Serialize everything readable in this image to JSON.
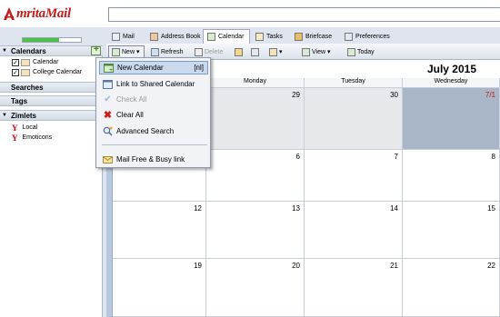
{
  "app": {
    "logo_prefix": "A",
    "logo_text": "mrita",
    "logo_suffix": "Mail"
  },
  "quota": {
    "used_fraction": 0.62
  },
  "sidebar": {
    "calendars_header": "Calendars",
    "calendars": [
      {
        "label": "Calendar",
        "checked": true,
        "color": "#f3e3b8"
      },
      {
        "label": "College Calendar",
        "checked": true,
        "color": "#f3e3b8"
      }
    ],
    "searches_header": "Searches",
    "tags_header": "Tags",
    "zimlets_header": "Zimlets",
    "zimlets": [
      {
        "label": "Local",
        "icon": "yahoo-icon"
      },
      {
        "label": "Emoticons",
        "icon": "yahoo-icon"
      }
    ]
  },
  "apptabs": [
    {
      "label": "Mail",
      "icon": "mail-icon"
    },
    {
      "label": "Address Book",
      "icon": "address-book-icon"
    },
    {
      "label": "Calendar",
      "icon": "calendar-icon",
      "active": true
    },
    {
      "label": "Tasks",
      "icon": "tasks-icon"
    },
    {
      "label": "Briefcase",
      "icon": "briefcase-icon"
    },
    {
      "label": "Preferences",
      "icon": "preferences-icon"
    }
  ],
  "toolbar": {
    "new_label": "New",
    "refresh_label": "Refresh",
    "delete_label": "Delete",
    "view_label": "View",
    "today_label": "Today"
  },
  "calendar": {
    "month_title": "July 2015",
    "day_headers": [
      "",
      "Monday",
      "Tuesday",
      "Wednesday"
    ],
    "weeks": [
      [
        "",
        "29",
        "30",
        "7/1"
      ],
      [
        "",
        "6",
        "7",
        "8"
      ],
      [
        "12",
        "13",
        "14",
        "15"
      ],
      [
        "19",
        "20",
        "21",
        "22"
      ]
    ]
  },
  "menu": {
    "items": [
      {
        "label": "New Calendar",
        "shortcut": "[nl]",
        "icon": "new-calendar-icon",
        "selected": true
      },
      {
        "label": "Link to Shared Calendar",
        "icon": "shared-calendar-icon"
      },
      {
        "label": "Check All",
        "icon": "check-icon",
        "disabled": true
      },
      {
        "label": "Clear All",
        "icon": "clear-icon"
      },
      {
        "label": "Advanced Search",
        "icon": "advanced-search-icon"
      },
      {
        "label": "Mail Free & Busy link",
        "icon": "mail-icon"
      }
    ]
  }
}
